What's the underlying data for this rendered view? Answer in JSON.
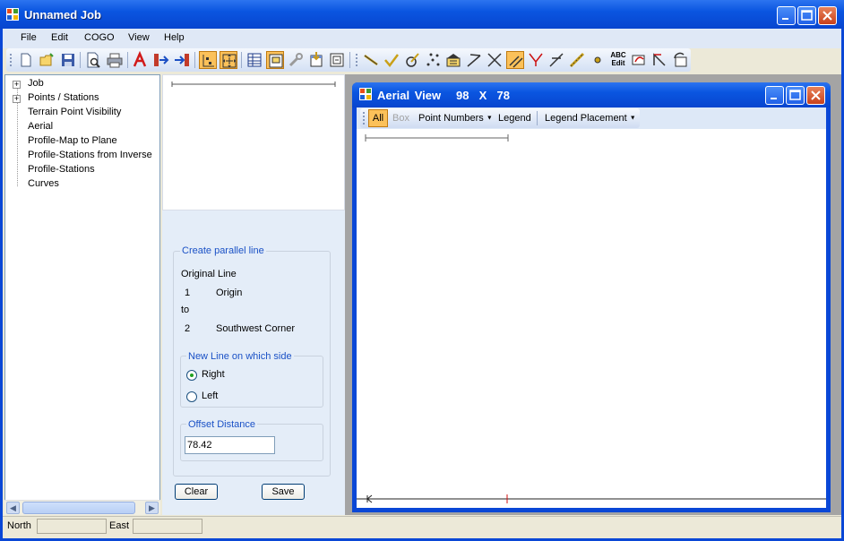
{
  "window": {
    "title": "Unnamed Job",
    "icon": "app-grid-icon"
  },
  "menu": {
    "items": [
      "File",
      "Edit",
      "COGO",
      "View",
      "Help"
    ]
  },
  "toolbar": {
    "icons": [
      "new-file-icon",
      "open-folder-icon",
      "save-disk-icon",
      "print-preview-icon",
      "print-icon",
      "font-icon",
      "export-arrow-icon",
      "import-arrow-icon",
      "layout-icon",
      "fit-extent-icon",
      "table-grid-icon",
      "frame-icon",
      "wrench-icon",
      "import-window-icon",
      "export-window-icon",
      "line-icon",
      "check-line-icon",
      "circle-point-icon",
      "points-scatter-icon",
      "building-icon",
      "angle-icon",
      "intersect-icon",
      "parallel-line-icon",
      "bearing-icon",
      "perpendicular-icon",
      "measure-icon",
      "point-dot-icon",
      "abc-edit-icon",
      "curve-edit-icon",
      "offset-corner-icon",
      "rotate-icon"
    ],
    "abc_edit_text": "ABC Edit"
  },
  "tree": {
    "items": [
      {
        "label": "Job",
        "expandable": true
      },
      {
        "label": "Points / Stations",
        "expandable": true
      },
      {
        "label": "Terrain Point Visibility",
        "expandable": false
      },
      {
        "label": "Aerial",
        "expandable": false
      },
      {
        "label": "Profile-Map to Plane",
        "expandable": false
      },
      {
        "label": "Profile-Stations from Inverse",
        "expandable": false
      },
      {
        "label": "Profile-Stations",
        "expandable": false
      },
      {
        "label": "Curves",
        "expandable": false
      }
    ]
  },
  "parallel_panel": {
    "group_title": "Create parallel line",
    "original_line_label": "Original Line",
    "from_number": "1",
    "from_name": "Origin",
    "to_label": "to",
    "to_number": "2",
    "to_name": "Southwest Corner",
    "side_group_title": "New Line on which side",
    "side_options": [
      {
        "label": "Right",
        "checked": true
      },
      {
        "label": "Left",
        "checked": false
      }
    ],
    "offset_group_title": "Offset Distance",
    "offset_value": "78.42",
    "clear_label": "Clear",
    "save_label": "Save"
  },
  "aerial": {
    "title": "Aerial View   98  X  78",
    "toolbar": {
      "all_label": "All",
      "box_label": "Box",
      "point_numbers_label": "Point Numbers",
      "legend_label": "Legend",
      "legend_placement_label": "Legend Placement"
    }
  },
  "status": {
    "north_label": "North",
    "north_value": "",
    "east_label": "East",
    "east_value": ""
  },
  "colors": {
    "title_blue": "#0a55e0",
    "panel_bg": "#e4edf8",
    "group_title": "#1a51c6",
    "toolbar_highlight": "#fbc15a",
    "mark_red": "#d01010"
  }
}
